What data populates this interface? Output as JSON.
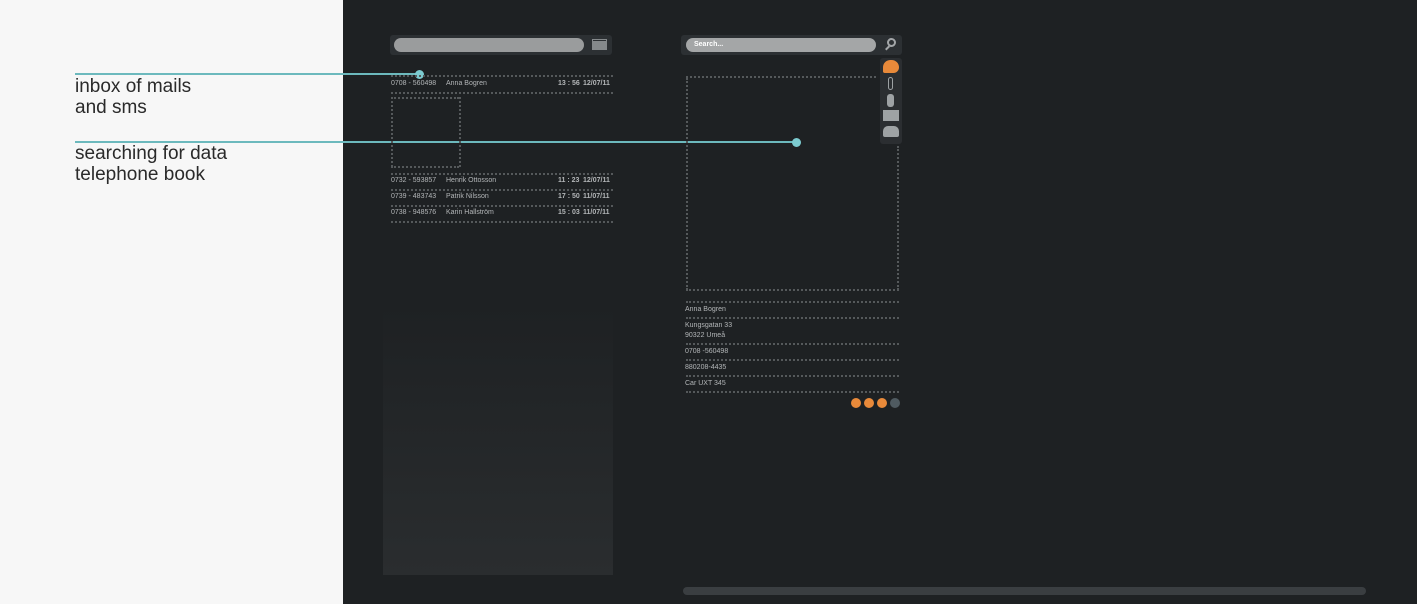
{
  "annotations": {
    "inbox_line1": "inbox of mails",
    "inbox_line2": "and sms",
    "search_line1": "searching for data",
    "search_line2": "telephone book"
  },
  "inbox": {
    "messages": [
      {
        "number": "0708 - 560498",
        "name": "Anna Bogren",
        "time": "13 : 56",
        "date": "12/07/11"
      },
      {
        "number": "0732 - 593857",
        "name": "Henrik Ottosson",
        "time": "11 : 23",
        "date": "12/07/11"
      },
      {
        "number": "0739 - 483743",
        "name": "Patrik Nilsson",
        "time": "17 : 50",
        "date": "11/07/11"
      },
      {
        "number": "0738 - 948576",
        "name": "Karin Hallström",
        "time": "15 : 03",
        "date": "11/07/11"
      }
    ]
  },
  "search": {
    "placeholder": "Search..."
  },
  "contact": {
    "name": "Anna Bogren",
    "street": "Kungsgatan 33",
    "city": "90322 Umeå",
    "phone": "0708 -560498",
    "id": "880208-4435",
    "car": "Car UXT 345"
  },
  "icons": {
    "toolstrip": [
      "ear-icon",
      "paperclip-icon",
      "phone-icon",
      "mail-icon",
      "car-icon"
    ],
    "bottom": [
      "ear-icon",
      "info-icon",
      "location-icon",
      "car-icon"
    ]
  },
  "colors": {
    "accent_orange": "#e98a3a",
    "annotation_line": "#6cb9bd",
    "background_dark": "#1e2123"
  }
}
